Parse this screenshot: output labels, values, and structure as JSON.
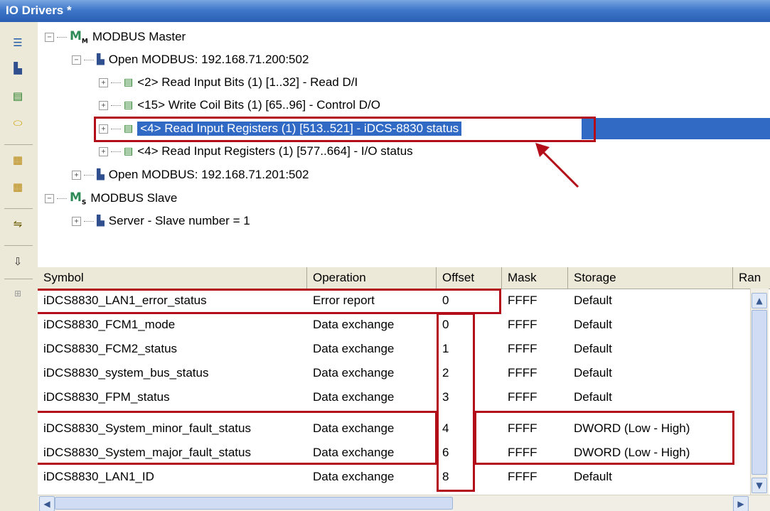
{
  "window": {
    "title": "IO Drivers *"
  },
  "toolbar": {
    "icons": [
      "tree-view-icon",
      "network-icon",
      "block-icon",
      "connect-icon",
      "table-icon",
      "table-add-icon",
      "link-icon",
      "sort-icon",
      "expand-icon"
    ]
  },
  "tree": {
    "nodes": [
      {
        "label": "MODBUS Master",
        "icon": "modbus-master-icon",
        "expander": "−"
      },
      {
        "label": "Open MODBUS: 192.168.71.200:502",
        "icon": "network-icon",
        "expander": "−"
      },
      {
        "label": "<2> Read Input Bits (1) [1..32] - Read D/I",
        "icon": "block-icon",
        "expander": "+"
      },
      {
        "label": "<15> Write Coil Bits (1) [65..96] - Control D/O",
        "icon": "block-icon",
        "expander": "+"
      },
      {
        "label": "<4> Read Input Registers (1) [513..521] - iDCS-8830 status",
        "icon": "block-icon",
        "expander": "+"
      },
      {
        "label": "<4> Read Input Registers (1) [577..664] - I/O status",
        "icon": "block-icon",
        "expander": "+"
      },
      {
        "label": "Open MODBUS: 192.168.71.201:502",
        "icon": "network-icon",
        "expander": "+"
      },
      {
        "label": "MODBUS Slave",
        "icon": "modbus-slave-icon",
        "expander": "−"
      },
      {
        "label": "Server - Slave number = 1",
        "icon": "network-icon",
        "expander": "+"
      }
    ]
  },
  "grid": {
    "columns": [
      "Symbol",
      "Operation",
      "Offset",
      "Mask",
      "Storage",
      "Ran"
    ],
    "rows": [
      {
        "symbol": "iDCS8830_LAN1_error_status",
        "operation": "Error report",
        "offset": "0",
        "mask": "FFFF",
        "storage": "Default"
      },
      {
        "symbol": "iDCS8830_FCM1_mode",
        "operation": "Data exchange",
        "offset": "0",
        "mask": "FFFF",
        "storage": "Default"
      },
      {
        "symbol": "iDCS8830_FCM2_status",
        "operation": "Data exchange",
        "offset": "1",
        "mask": "FFFF",
        "storage": "Default"
      },
      {
        "symbol": "iDCS8830_system_bus_status",
        "operation": "Data exchange",
        "offset": "2",
        "mask": "FFFF",
        "storage": "Default"
      },
      {
        "symbol": "iDCS8830_FPM_status",
        "operation": "Data exchange",
        "offset": "3",
        "mask": "FFFF",
        "storage": "Default"
      },
      {
        "symbol": "iDCS8830_System_minor_fault_status",
        "operation": "Data exchange",
        "offset": "4",
        "mask": "FFFF",
        "storage": "DWORD (Low - High)"
      },
      {
        "symbol": "iDCS8830_System_major_fault_status",
        "operation": "Data exchange",
        "offset": "6",
        "mask": "FFFF",
        "storage": "DWORD (Low - High)"
      },
      {
        "symbol": "iDCS8830_LAN1_ID",
        "operation": "Data exchange",
        "offset": "8",
        "mask": "FFFF",
        "storage": "Default"
      }
    ]
  },
  "colors": {
    "selection": "#316ac5",
    "annotation": "#b30d1a",
    "titlebar": "#3f77c9"
  }
}
